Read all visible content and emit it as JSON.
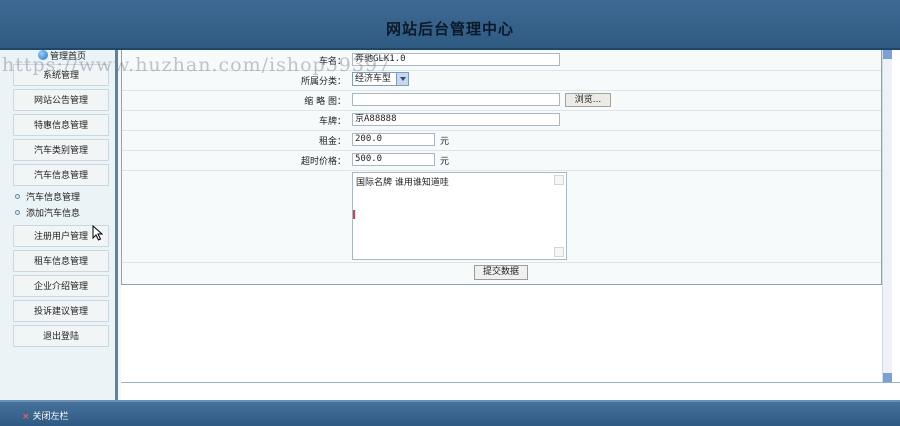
{
  "header": {
    "title": "网站后台管理中心"
  },
  "sidebar": {
    "home": "管理首页",
    "items": [
      "系统管理",
      "网站公告管理",
      "特惠信息管理",
      "汽车类别管理",
      "汽车信息管理"
    ],
    "subitems": [
      "汽车信息管理",
      "添加汽车信息"
    ],
    "items_after": [
      "注册用户管理",
      "租车信息管理",
      "企业介绍管理",
      "投诉建议管理",
      "退出登陆"
    ]
  },
  "form": {
    "name_label": "车名：",
    "name_value": "奔驰GLK1.0",
    "category_label": "所属分类：",
    "category_value": "经济车型",
    "thumb_label": "缩 略 图：",
    "thumb_value": "",
    "browse_label": "浏览...",
    "plate_label": "车牌：",
    "plate_value": "京A88888",
    "rent_label": "租金：",
    "rent_value": "200.0",
    "rent_unit": "元",
    "overtime_label": "超时价格：",
    "overtime_value": "500.0",
    "overtime_unit": "元",
    "description": "国际名牌 谁用谁知道哇",
    "submit_label": "提交数据"
  },
  "footer": {
    "close_label": "关闭左栏"
  },
  "watermark": "https://www.huzhan.com/ishop39397"
}
